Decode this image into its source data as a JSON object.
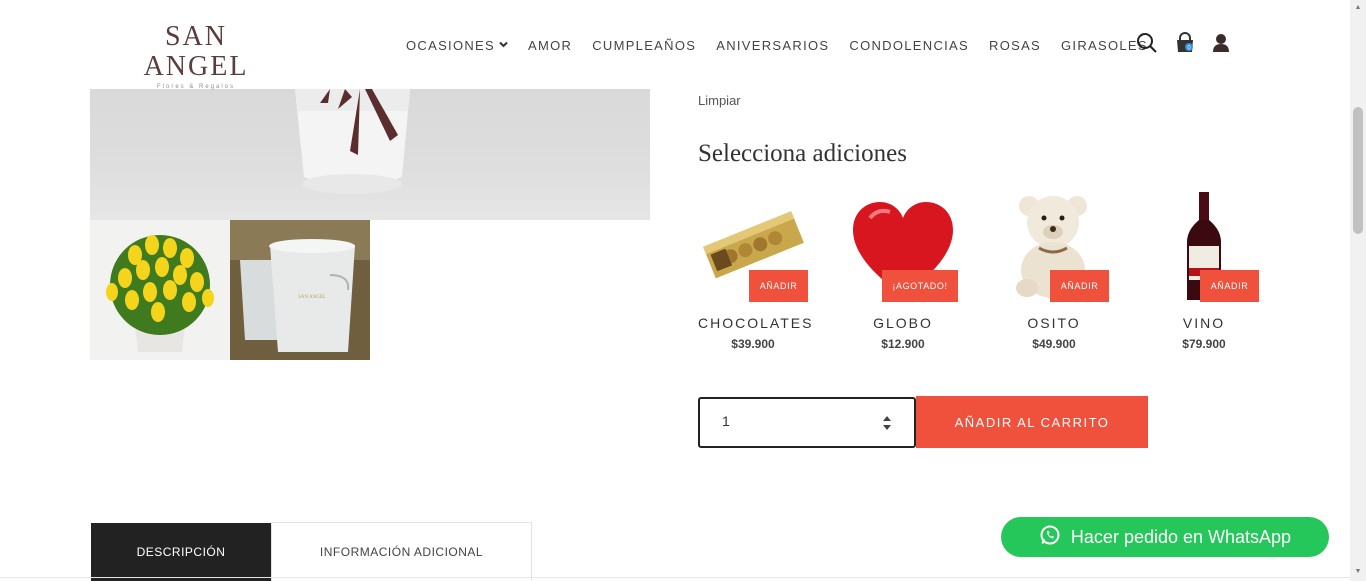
{
  "header": {
    "logo": {
      "main": "SAN ANGEL",
      "sub": "Flores & Regalos"
    },
    "nav": [
      {
        "label": "OCASIONES",
        "has_dropdown": true
      },
      {
        "label": "AMOR"
      },
      {
        "label": "CUMPLEAÑOS"
      },
      {
        "label": "ANIVERSARIOS"
      },
      {
        "label": "CONDOLENCIAS"
      },
      {
        "label": "ROSAS"
      },
      {
        "label": "GIRASOLES"
      }
    ],
    "icons": [
      "search-icon",
      "shopping-bag-icon",
      "user-icon"
    ],
    "cart_count": "0"
  },
  "product": {
    "clear_link": "Limpiar",
    "addons_title": "Selecciona adiciones",
    "addons": [
      {
        "name": "CHOCOLATES",
        "price": "$39.900",
        "button": "AÑADIR"
      },
      {
        "name": "GLOBO",
        "price": "$12.900",
        "button": "¡AGOTADO!"
      },
      {
        "name": "OSITO",
        "price": "$49.900",
        "button": "AÑADIR"
      },
      {
        "name": "VINO",
        "price": "$79.900",
        "button": "AÑADIR"
      }
    ],
    "quantity": "1",
    "add_to_cart": "AÑADIR AL CARRITO"
  },
  "tabs": [
    {
      "label": "DESCRIPCIÓN",
      "active": true
    },
    {
      "label": "INFORMACIÓN ADICIONAL",
      "active": false
    }
  ],
  "whatsapp": {
    "label": "Hacer pedido en WhatsApp"
  },
  "colors": {
    "accent": "#f0513d",
    "whatsapp": "#25c65a",
    "dark": "#222222"
  }
}
